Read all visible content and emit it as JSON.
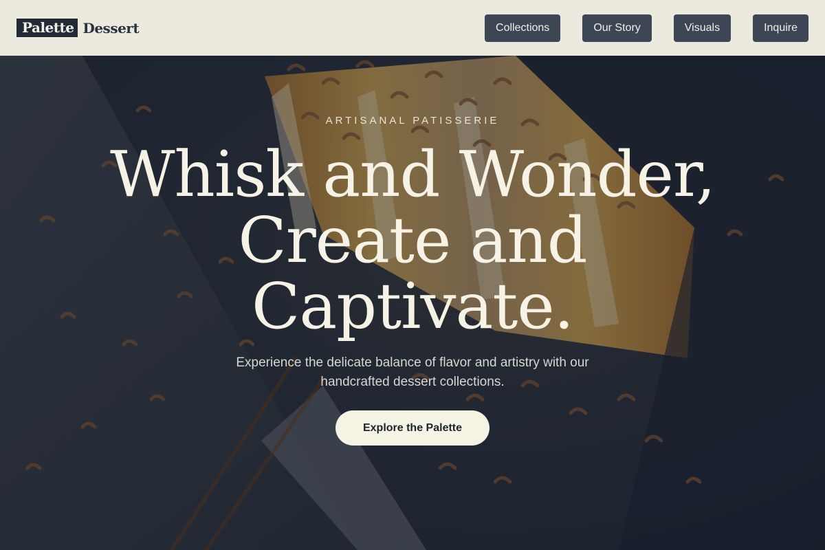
{
  "brand": {
    "logo_box": "Palette",
    "logo_text": "Dessert"
  },
  "nav": {
    "items": [
      "Collections",
      "Our Story",
      "Visuals",
      "Inquire"
    ]
  },
  "hero": {
    "eyebrow": "ARTISANAL PATISSERIE",
    "headline_lines": [
      "Whisk and Wonder,",
      "Create and",
      "Captivate."
    ],
    "subtext": "Experience the delicate balance of flavor and artistry with our handcrafted dessert collections.",
    "cta_label": "Explore the Palette"
  },
  "colors": {
    "header_bg": "#eceade",
    "nav_button_bg": "#3d4654",
    "cta_bg": "#f5f3e3",
    "headline": "#f6f3e6"
  }
}
